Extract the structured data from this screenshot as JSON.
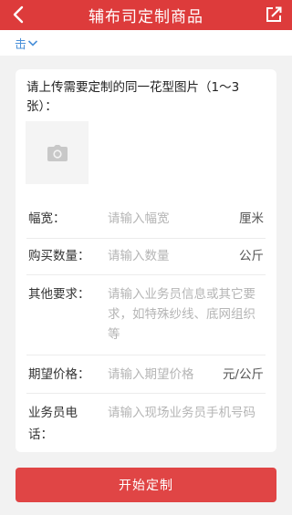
{
  "header": {
    "title": "辅布司定制商品"
  },
  "subbar": {
    "tab_text": "击"
  },
  "form": {
    "upload_label": "请上传需要定制的同一花型图片（1～3张）：",
    "width": {
      "label": "幅宽：",
      "placeholder": "请输入幅宽",
      "unit": "厘米"
    },
    "quantity": {
      "label": "购买数量：",
      "placeholder": "请输入数量",
      "unit": "公斤"
    },
    "other": {
      "label": "其他要求：",
      "placeholder_lines": [
        "请输入业务员信息或其它要",
        "求，如特殊纱线、底网组织",
        "等"
      ]
    },
    "price": {
      "label": "期望价格：",
      "placeholder": "请输入期望价格",
      "unit": "元/公斤"
    },
    "phone": {
      "label_lines": [
        "业务员电",
        "话："
      ],
      "placeholder": "请输入现场业务员手机号码"
    }
  },
  "submit": {
    "label": "开始定制"
  },
  "colors": {
    "header_bg": "#dd3b3b",
    "button_bg": "#e04545",
    "link_blue": "#4a90d9"
  },
  "icons": [
    "back-icon",
    "share-edit-icon",
    "chevron-down-icon",
    "camera-icon"
  ]
}
